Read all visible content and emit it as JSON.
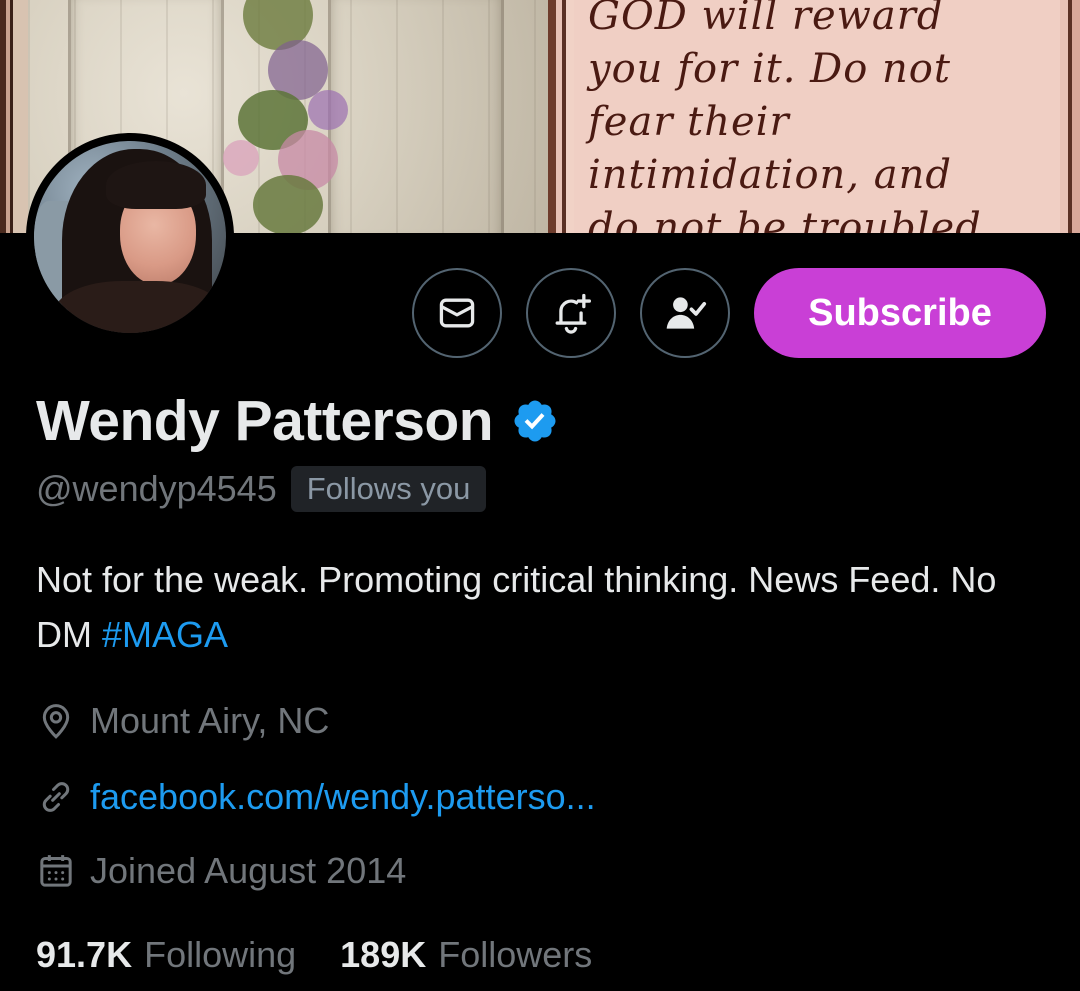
{
  "banner": {
    "quote_lines": [
      "GOD will reward",
      "you for it. Do not",
      "fear their",
      "intimidation, and",
      "do not be troubled"
    ]
  },
  "actions": {
    "message_icon": "envelope-icon",
    "notify_icon": "bell-plus-icon",
    "following_icon": "person-check-icon",
    "subscribe_label": "Subscribe",
    "subscribe_color": "#c93fd6"
  },
  "profile": {
    "name": "Wendy Patterson",
    "verified": true,
    "handle": "@wendyp4545",
    "follows_you": "Follows you",
    "bio_text": "Not for the weak. Promoting critical thinking. News Feed. No DM ",
    "bio_hashtag": "#MAGA",
    "location": "Mount Airy, NC",
    "website": "facebook.com/wendy.patterso...",
    "joined": "Joined August 2014"
  },
  "stats": {
    "following_count": "91.7K",
    "following_label": "Following",
    "followers_count": "189K",
    "followers_label": "Followers"
  },
  "colors": {
    "background": "#000000",
    "primary_text": "#e7e9ea",
    "secondary_text": "#71767b",
    "link": "#1d9bf0",
    "verified": "#1d9bf0"
  }
}
